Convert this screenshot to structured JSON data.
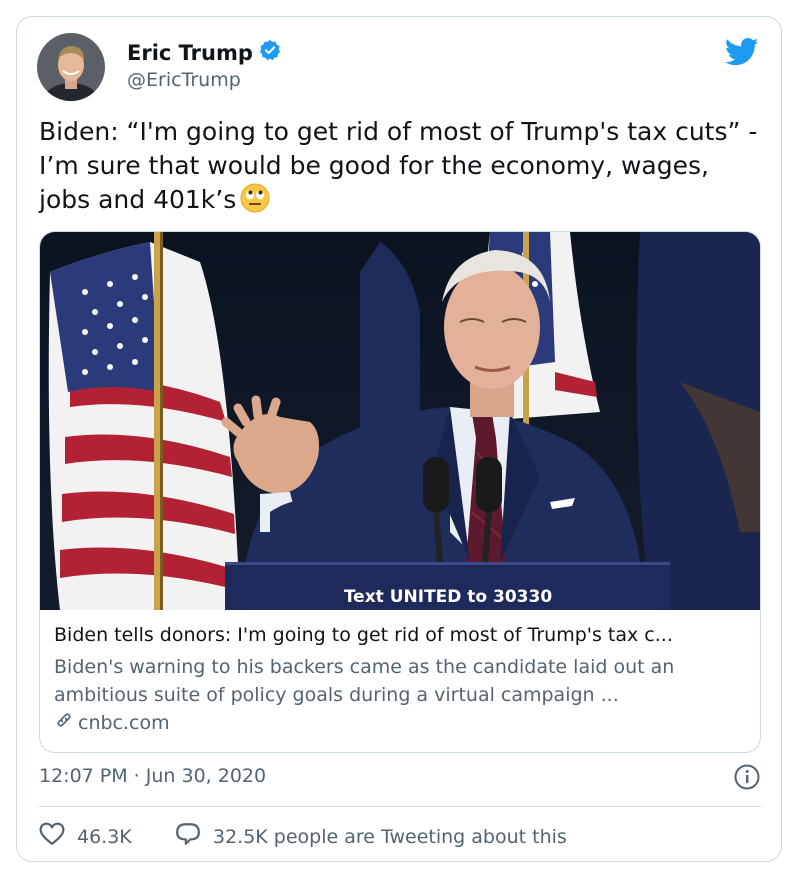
{
  "author": {
    "display_name": "Eric Trump",
    "handle": "@EricTrump"
  },
  "tweet": {
    "text": "Biden: “I'm going to get rid of most of Trump's tax cuts” - I’m sure that would be good for the economy, wages, jobs and 401k’s",
    "emoji_icon": "face-with-rolling-eyes-icon"
  },
  "link_card": {
    "image_caption": "Text UNITED to 30330",
    "title": "Biden tells donors: I'm going to get rid of most of Trump's tax c...",
    "description": "Biden's warning to his backers came as the candidate laid out an ambitious suite of policy goals during a virtual campaign ...",
    "domain": "cnbc.com"
  },
  "meta": {
    "timestamp": "12:07 PM · Jun 30, 2020"
  },
  "stats": {
    "likes": "46.3K",
    "tweeting_text": "32.5K people are Tweeting about this"
  },
  "colors": {
    "twitter_blue": "#1d9bf0",
    "secondary_text": "#536471",
    "border": "#cfd9de"
  }
}
